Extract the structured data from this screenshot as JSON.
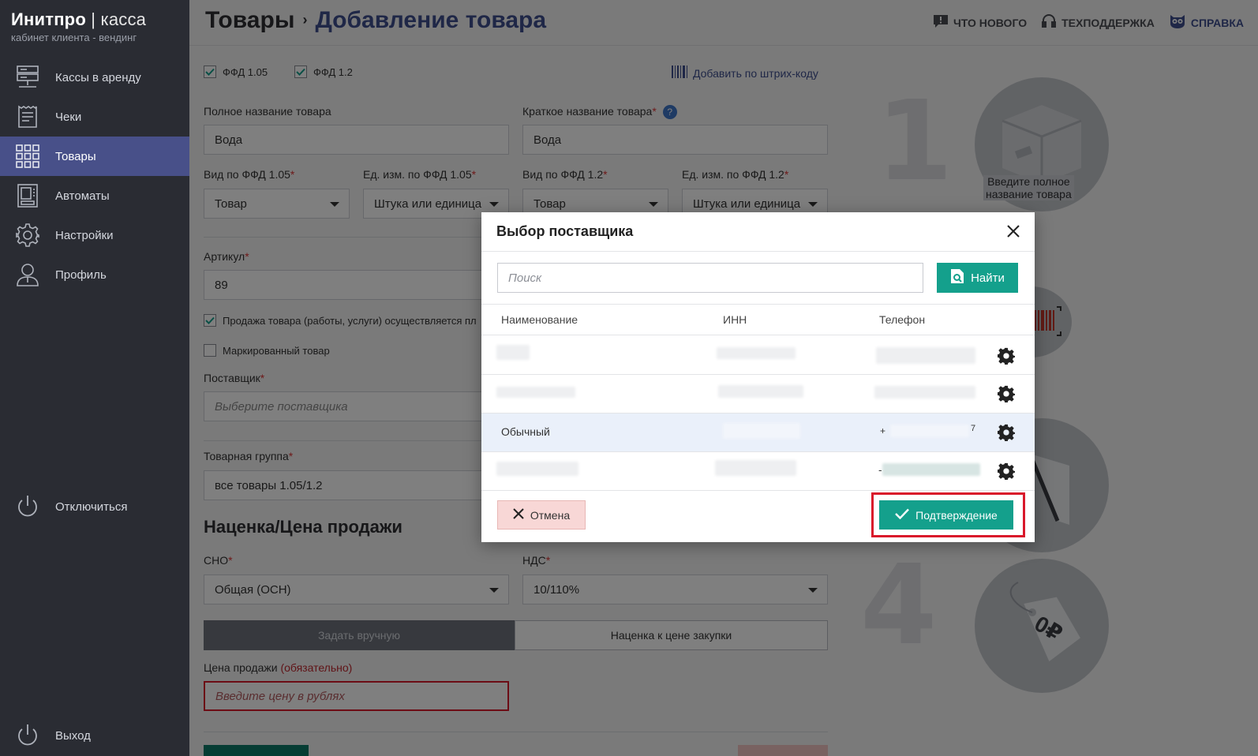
{
  "app": {
    "logo_main": "Инитпро",
    "logo_sep": " | ",
    "logo_product": "касса",
    "logo_sub": "кабинет клиента - вендинг"
  },
  "sidebar": {
    "items": [
      {
        "label": "Кассы в аренду",
        "icon": "server-icon"
      },
      {
        "label": "Чеки",
        "icon": "receipt-icon"
      },
      {
        "label": "Товары",
        "icon": "grid-icon",
        "active": true
      },
      {
        "label": "Автоматы",
        "icon": "vending-machine-icon"
      },
      {
        "label": "Настройки",
        "icon": "gear-icon"
      },
      {
        "label": "Профиль",
        "icon": "user-icon"
      }
    ],
    "disconnect_label": "Отключиться",
    "logout_label": "Выход"
  },
  "header": {
    "crumb_root": "Товары",
    "crumb_sep": "›",
    "crumb_current": "Добавление товара",
    "links": {
      "whats_new": "ЧТО НОВОГО",
      "support": "ТЕХПОДДЕРЖКА",
      "help": "СПРАВКА"
    }
  },
  "form": {
    "ffd105_label": "ФФД 1.05",
    "ffd12_label": "ФФД 1.2",
    "barcode_link": "Добавить по штрих-коду",
    "full_name_label": "Полное название товара",
    "full_name_value": "Вода",
    "short_name_label": "Краткое название товара",
    "short_name_value": "Вода",
    "req": "*",
    "type105_label": "Вид по ФФД 1.05",
    "type105_value": "Товар",
    "unit105_label": "Ед. изм. по ФФД 1.05",
    "unit105_value": "Штука или единица",
    "type12_label": "Вид по ФФД 1.2",
    "type12_value": "Товар",
    "unit12_label": "Ед. изм. по ФФД 1.2",
    "unit12_value": "Штука или единица",
    "article_label": "Артикул",
    "article_value": "89",
    "sale_checkbox_label": "Продажа товара (работы, услуги) осуществляется пл",
    "marked_checkbox_label": "Маркированный товар",
    "supplier_label": "Поставщик",
    "supplier_placeholder": "Выберите поставщика",
    "group_label": "Товарная группа",
    "group_value": "все товары 1.05/1.2",
    "pricing_title": "Наценка/Цена продажи",
    "sno_label": "СНО",
    "sno_value": "Общая (ОСН)",
    "vat_label": "НДС",
    "vat_value": "10/110%",
    "toggle_manual": "Задать вручную",
    "toggle_markup": "Наценка к цене закупки",
    "price_label": "Цена продажи",
    "price_required": "(обязательно)",
    "price_placeholder": "Введите цену в рублях"
  },
  "steps": {
    "step1_num": "1",
    "step1_caption_line1": "Введите полное",
    "step1_caption_line2": "название товара",
    "step4_num": "4",
    "price_tag_text": "0₽"
  },
  "modal": {
    "title": "Выбор поставщика",
    "search_placeholder": "Поиск",
    "find_button": "Найти",
    "columns": {
      "name": "Наименование",
      "inn": "ИНН",
      "phone": "Телефон"
    },
    "rows": [
      {
        "name": "",
        "selected": false
      },
      {
        "name": "",
        "selected": false
      },
      {
        "name": "Обычный",
        "phone_prefix": "+",
        "phone_suffix": "7",
        "selected": true
      },
      {
        "name": "",
        "phone_prefix": "-",
        "selected": false
      }
    ],
    "cancel_button": "Отмена",
    "confirm_button": "Подтверждение"
  },
  "colors": {
    "sidebar_bg": "#2a2c33",
    "sidebar_active": "#485089",
    "accent_teal": "#14a08c",
    "brand_blue": "#3f4f8e",
    "highlight_red": "#d9182b"
  }
}
